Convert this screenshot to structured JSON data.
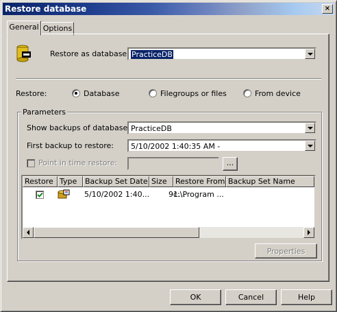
{
  "window": {
    "title": "Restore database",
    "close_label": "×"
  },
  "tabs": [
    {
      "label": "General"
    },
    {
      "label": "Options"
    }
  ],
  "restore_as": {
    "label": "Restore as database:",
    "value": "PracticeDB"
  },
  "restore": {
    "label": "Restore:",
    "options": [
      {
        "label": "Database",
        "selected": true
      },
      {
        "label": "Filegroups or files",
        "selected": false
      },
      {
        "label": "From device",
        "selected": false
      }
    ]
  },
  "parameters": {
    "label": "Parameters",
    "show_backups_label": "Show backups of database:",
    "show_backups_value": "PracticeDB",
    "first_backup_label": "First backup to restore:",
    "first_backup_value": "5/10/2002 1:40:35 AM -",
    "point_in_time_label": "Point in time restore:",
    "browse_label": "...",
    "properties_label": "Properties"
  },
  "grid": {
    "columns": [
      "Restore",
      "Type",
      "Backup Set Date",
      "Size",
      "Restore From",
      "Backup Set Name"
    ],
    "rows": [
      {
        "restore": true,
        "type_icon": "backup-set-icon",
        "date": "5/10/2002 1:40...",
        "size": "91...",
        "from": "c:\\Program ...",
        "name": ""
      }
    ]
  },
  "buttons": {
    "ok": "OK",
    "cancel": "Cancel",
    "help": "Help"
  }
}
